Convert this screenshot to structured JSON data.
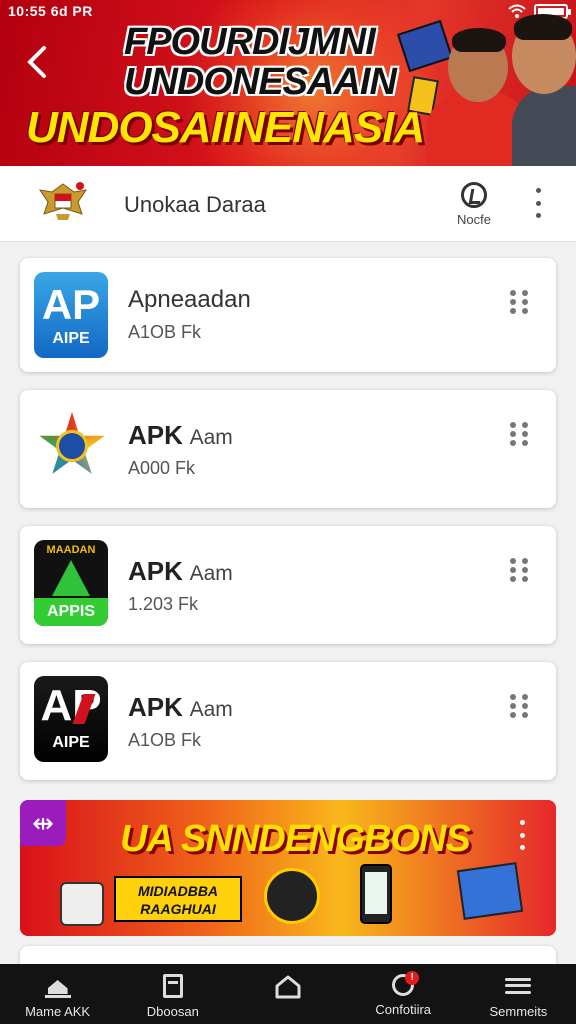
{
  "status_bar": {
    "time": "10:55 6d PR"
  },
  "banner": {
    "title": "FPOURDIJMNI\nUNDONESAAIN",
    "subtitle": "UNDOSAIINENASIA"
  },
  "appbar": {
    "title": "Unokaa Daraa",
    "mode_label": "Nocfe"
  },
  "apps": [
    {
      "name_main": "Apneaadan",
      "name_suffix": "",
      "size": "A1OB Fk",
      "icon_text": "AP",
      "icon_subtext": "AIPE"
    },
    {
      "name_main": "APK",
      "name_suffix": "Aam",
      "size": "A000 Fk",
      "icon_text": "",
      "icon_subtext": ""
    },
    {
      "name_main": "APK",
      "name_suffix": "Aam",
      "size": "1.203 Fk",
      "icon_text": "MAADAN",
      "icon_subtext": "APPIS"
    },
    {
      "name_main": "APK",
      "name_suffix": "Aam",
      "size": "A1OB Fk",
      "icon_text": "AP",
      "icon_subtext": "AIPE"
    }
  ],
  "promo": {
    "tag": "⇹",
    "headline": "UA SNNDENGBONS",
    "box_text": "MIDIADBBA RAAGHUAI"
  },
  "bottom_nav": [
    {
      "label": "Mame AKK",
      "icon": "home-icon"
    },
    {
      "label": "Dboosan",
      "icon": "document-icon"
    },
    {
      "label": "",
      "icon": "house-outline-icon"
    },
    {
      "label": "Confotiira",
      "icon": "notification-icon",
      "badge": "!"
    },
    {
      "label": "Semmeits",
      "icon": "menu-icon"
    }
  ],
  "colors": {
    "banner_red": "#d8141c",
    "banner_yellow": "#ffe600",
    "nav_bg": "#131313"
  }
}
